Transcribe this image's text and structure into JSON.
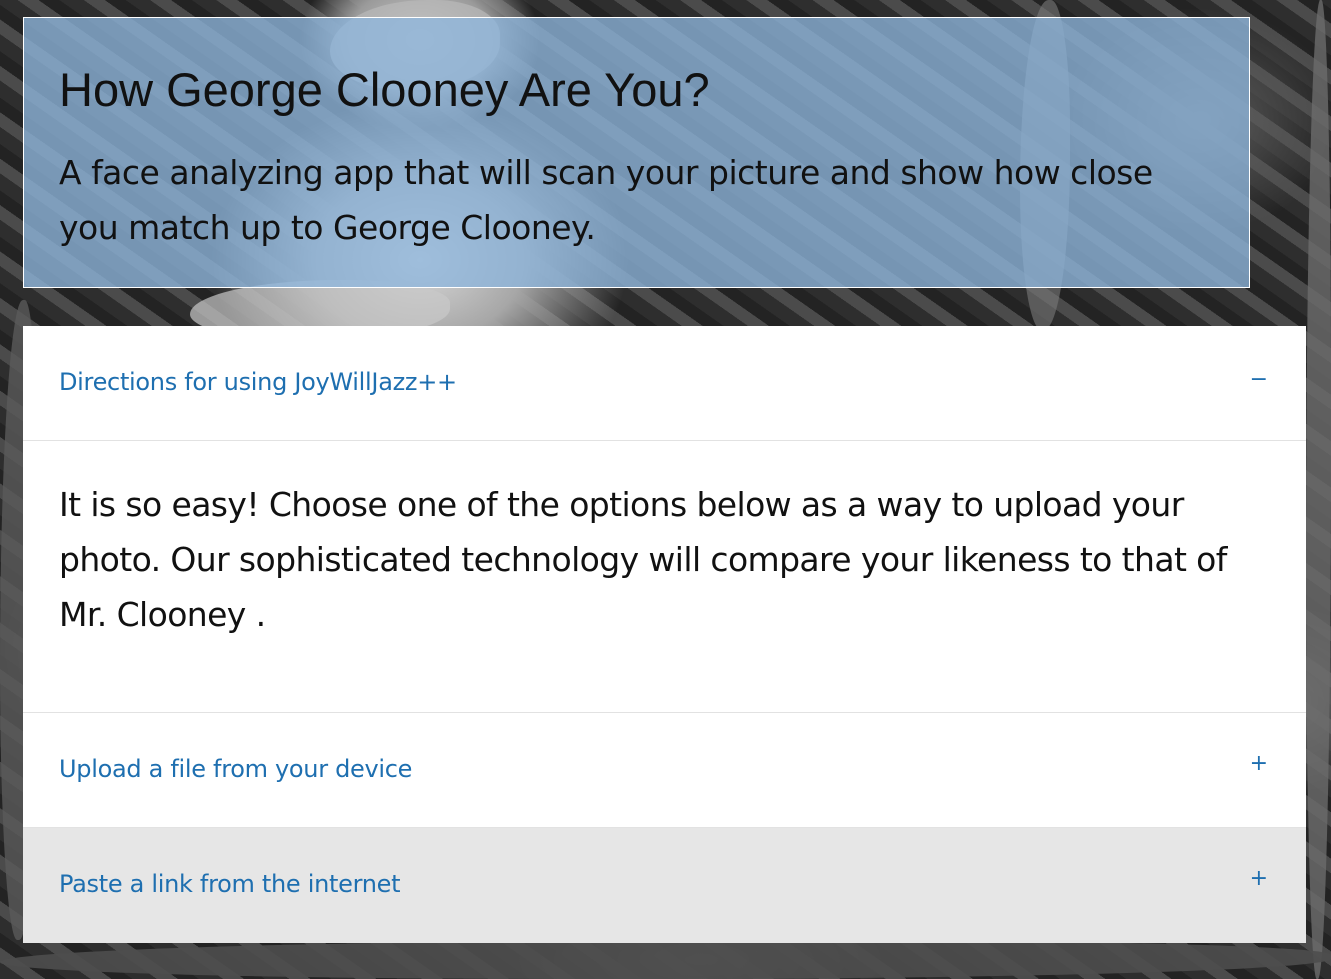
{
  "hero": {
    "title": "How George Clooney Are You?",
    "subtitle": "A face analyzing app that will scan your picture and show how close you match up to George Clooney."
  },
  "accordion": {
    "sections": [
      {
        "label": "Directions for using JoyWillJazz++",
        "toggle": "−",
        "expanded": true,
        "body": "It is so easy! Choose one of the options below as a way to upload your photo. Our sophisticated technology will compare your likeness to that of Mr. Clooney ."
      },
      {
        "label": "Upload a file from your device",
        "toggle": "+",
        "expanded": false
      },
      {
        "label": "Paste a link from the internet",
        "toggle": "+",
        "expanded": false
      }
    ]
  },
  "colors": {
    "hero_bg": "#8eb6dc",
    "link_blue": "#1e6fb0",
    "hover_gray": "#e6e6e6"
  },
  "background": {
    "icon": "forest-photographer-photo"
  }
}
